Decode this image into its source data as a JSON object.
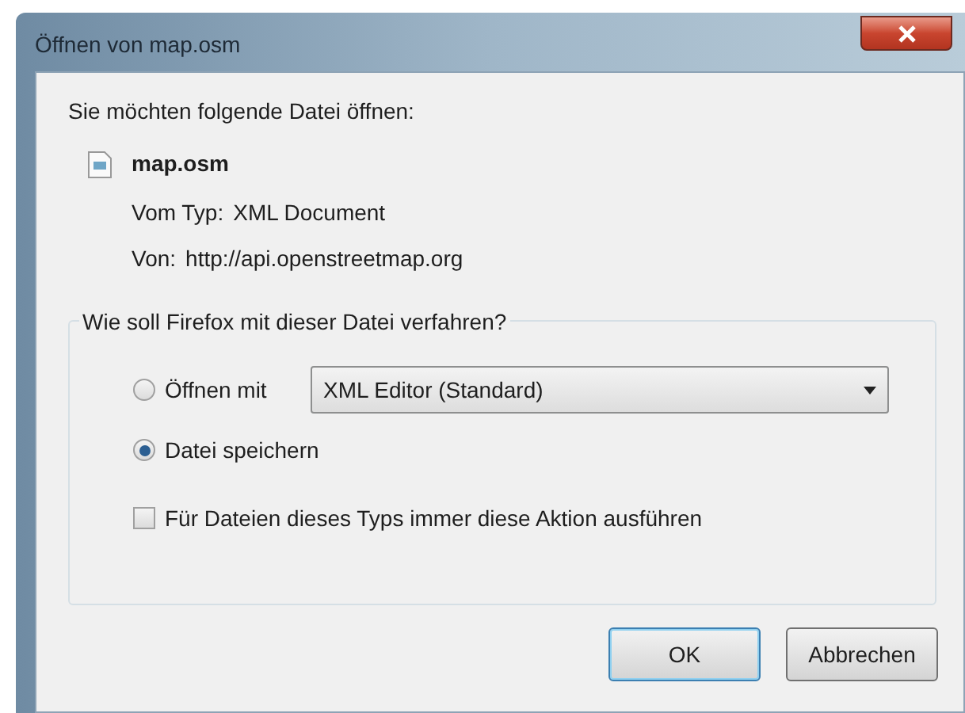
{
  "window": {
    "title": "Öffnen von map.osm"
  },
  "intro": "Sie möchten folgende Datei öffnen:",
  "file": {
    "name": "map.osm",
    "type_label": "Vom Typ:",
    "type": "XML Document",
    "from_label": "Von:",
    "from": "http://api.openstreetmap.org"
  },
  "group": {
    "title": "Wie soll Firefox mit dieser Datei verfahren?",
    "options": [
      {
        "kind": "radio",
        "label": "Öffnen mit",
        "selected": false,
        "dropdown": {
          "value": "XML Editor (Standard)"
        }
      },
      {
        "kind": "radio",
        "label": "Datei speichern",
        "selected": true
      },
      {
        "kind": "checkbox",
        "label": "Für Dateien dieses Typs immer diese Aktion ausführen",
        "checked": false
      }
    ]
  },
  "buttons": [
    {
      "label": "OK",
      "default": true
    },
    {
      "label": "Abbrechen",
      "default": false
    }
  ]
}
